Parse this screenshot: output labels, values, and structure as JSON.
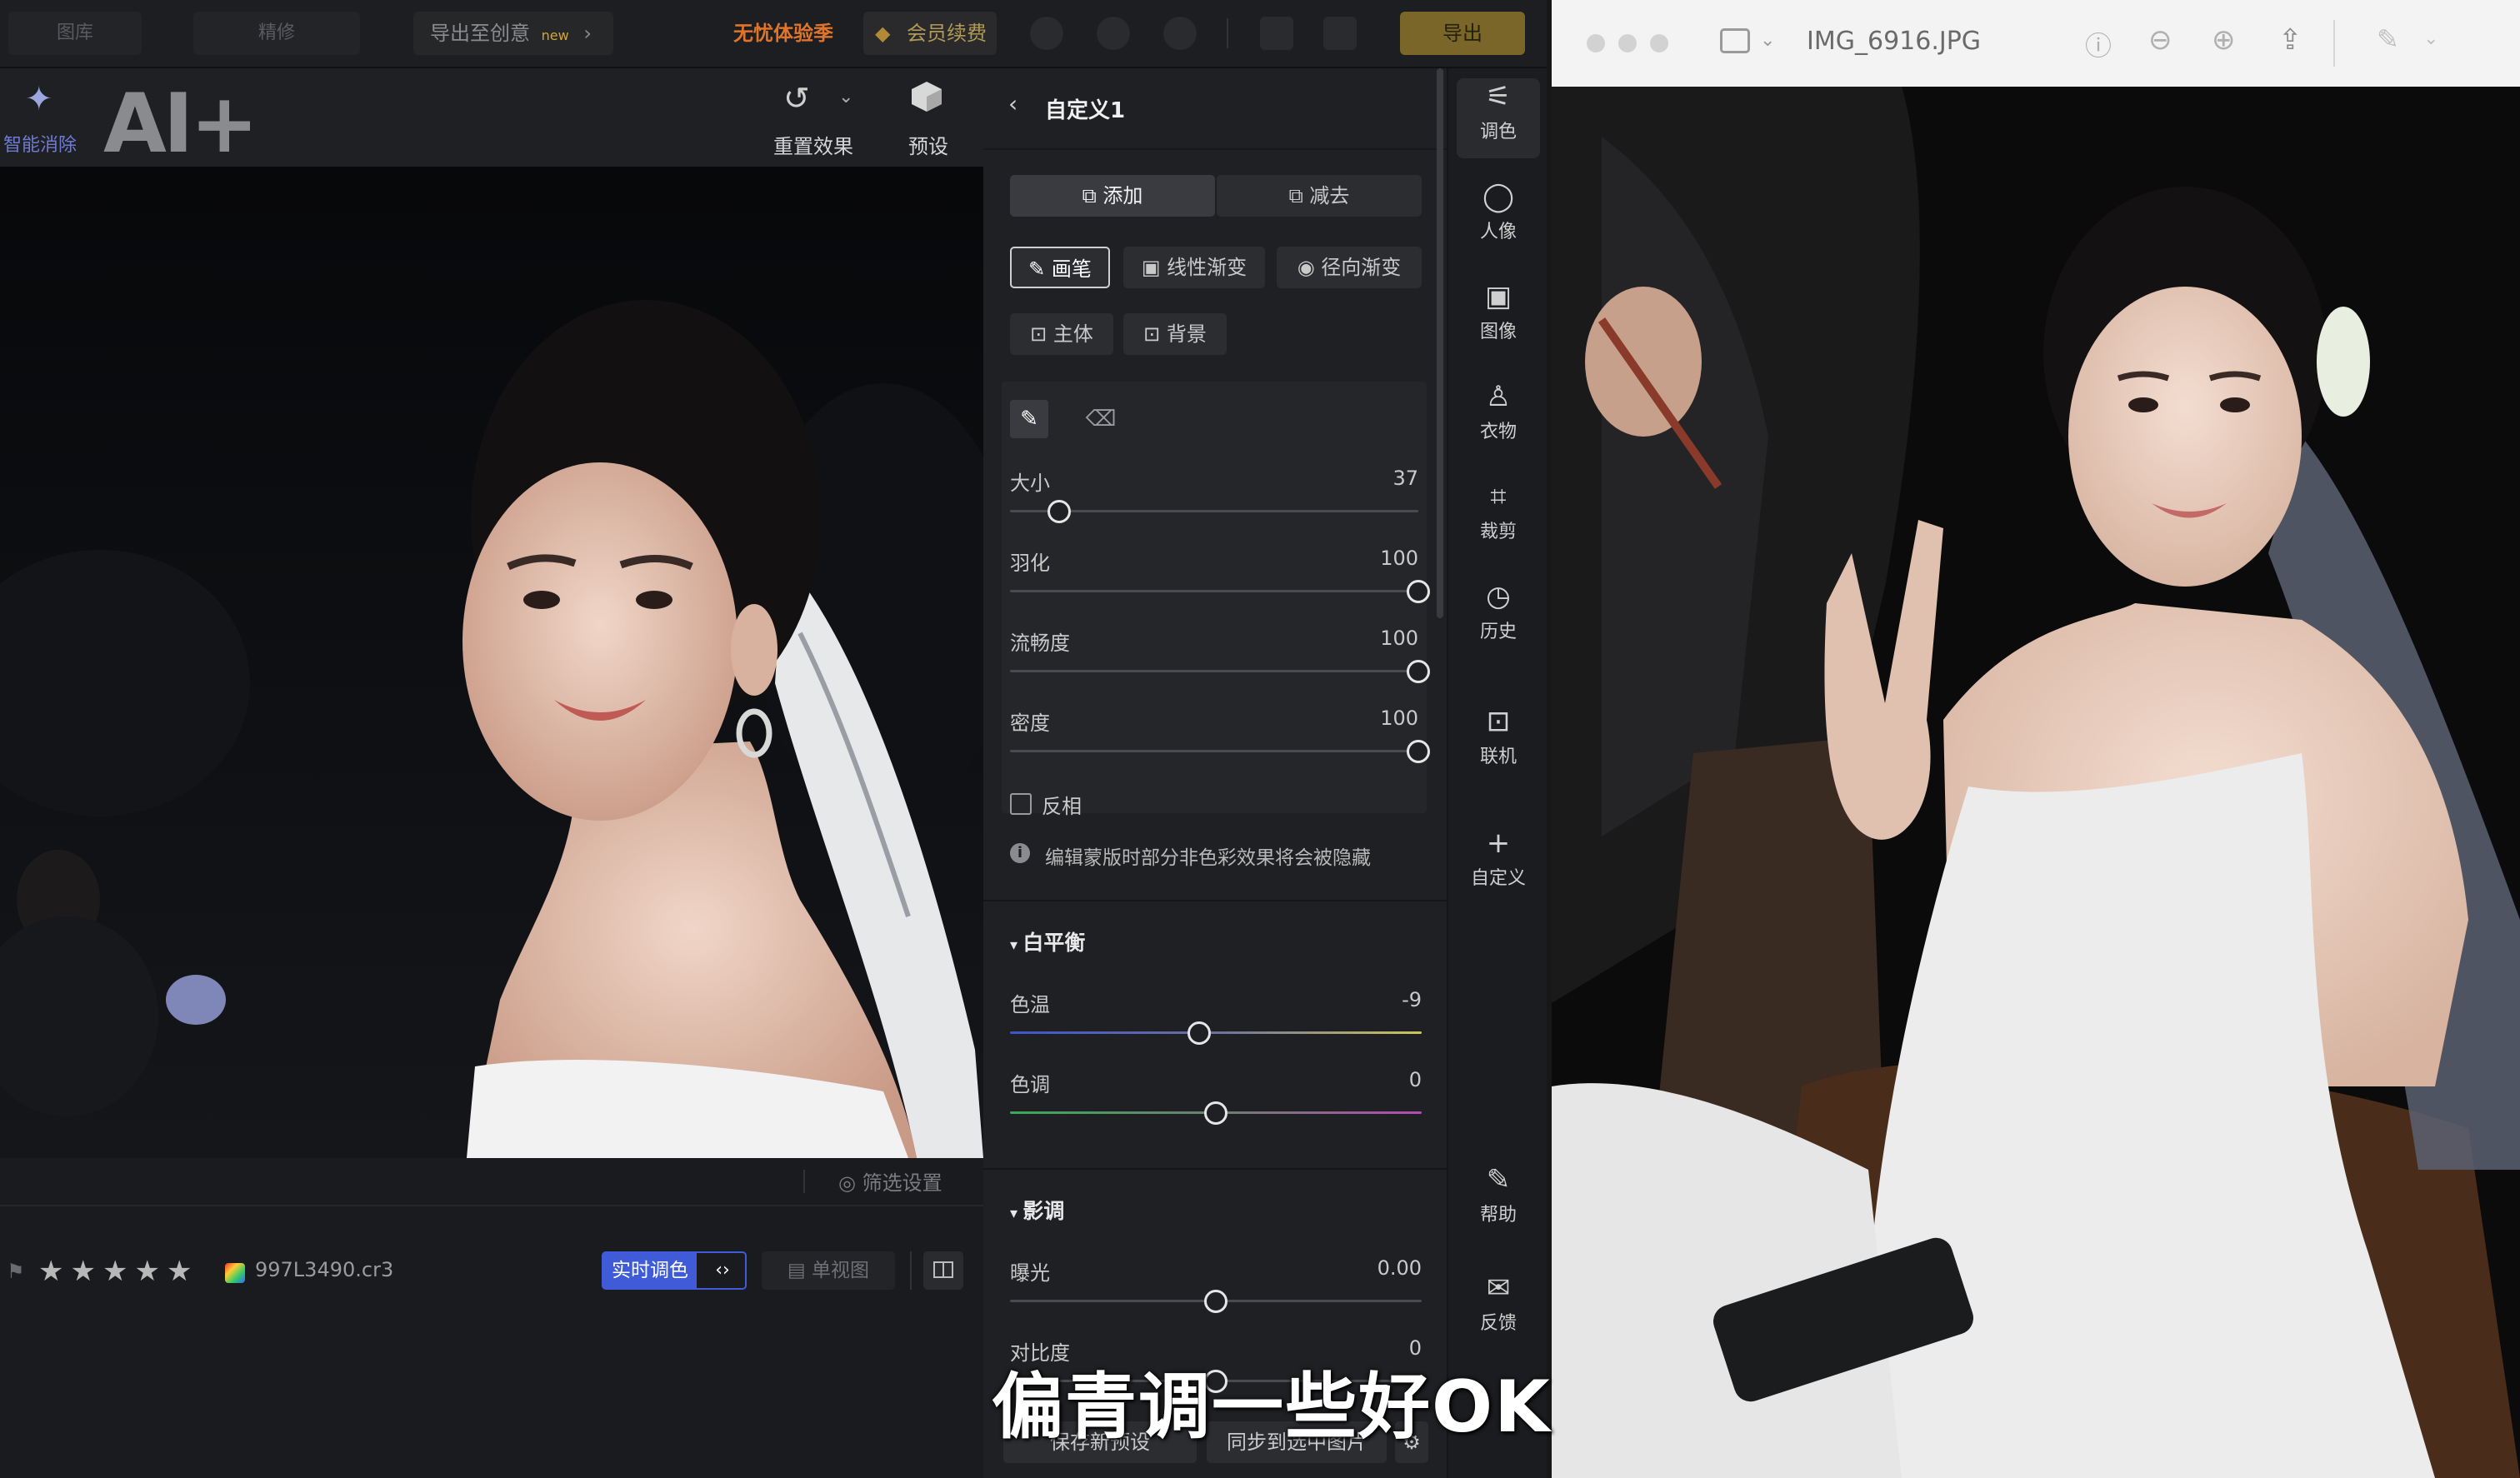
{
  "topbar": {
    "tab1": "图库",
    "tab2": "精修",
    "export_creative": "导出至创意",
    "export_badge": "new",
    "promo": "无忧体验季",
    "renew": "会员续费",
    "export_btn": "导出"
  },
  "toolbar": {
    "smart_erase": "智能消除",
    "ai_logo": "AI+",
    "reset": "重置效果",
    "preset": "预设"
  },
  "inspector": {
    "back_title": "自定义1",
    "add": "添加",
    "subtract": "减去",
    "brush": "画笔",
    "linear": "线性渐变",
    "radial": "径向渐变",
    "subject": "主体",
    "background": "背景",
    "sliders": [
      {
        "label": "大小",
        "value": "37",
        "fraction": 0.12
      },
      {
        "label": "羽化",
        "value": "100",
        "fraction": 1.0
      },
      {
        "label": "流畅度",
        "value": "100",
        "fraction": 1.0
      },
      {
        "label": "密度",
        "value": "100",
        "fraction": 1.0
      }
    ],
    "invert": "反相",
    "hint": "编辑蒙版时部分非色彩效果将会被隐藏",
    "wb": {
      "title": "白平衡",
      "temp": {
        "label": "色温",
        "value": "-9",
        "fraction": 0.46
      },
      "tint": {
        "label": "色调",
        "value": "0",
        "fraction": 0.5
      }
    },
    "tone": {
      "title": "影调",
      "exposure": {
        "label": "曝光",
        "value": "0.00",
        "fraction": 0.5
      },
      "contrast": {
        "label": "对比度",
        "value": "0",
        "fraction": 0.5
      }
    },
    "save_preset": "保存新预设",
    "sync": "同步到选中图片"
  },
  "rail": [
    "调色",
    "人像",
    "图像",
    "衣物",
    "裁剪",
    "历史",
    "联机",
    "自定义",
    "帮助",
    "反馈"
  ],
  "filmstrip": {
    "filter": "筛选设置",
    "filename": "997L3490.cr3",
    "live": "实时调色",
    "single_view": "单视图",
    "rating": 5
  },
  "viewer": {
    "filename": "IMG_6916.JPG"
  },
  "subtitle": "偏青调一些好OK",
  "colors": {
    "accent_blue": "#3f5bd8",
    "gold": "#c9a233",
    "orange": "#e0742a"
  }
}
